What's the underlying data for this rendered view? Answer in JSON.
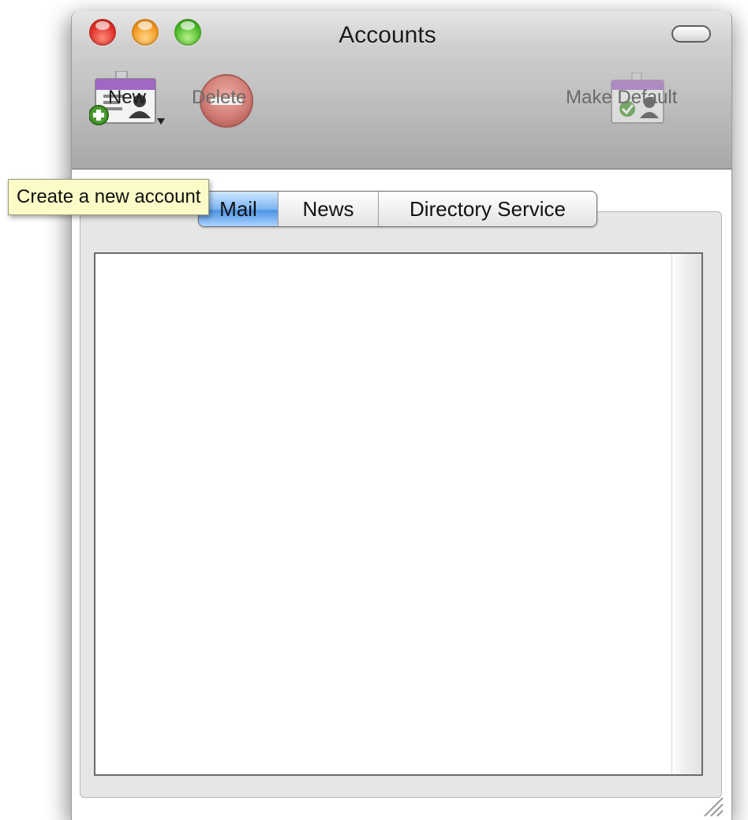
{
  "window": {
    "title": "Accounts"
  },
  "toolbar": {
    "new_label": "New",
    "delete_label": "Delete",
    "make_default_label": "Make Default"
  },
  "tooltip": {
    "text": "Create a new account"
  },
  "tabs": [
    {
      "label": "Mail",
      "selected": true
    },
    {
      "label": "News",
      "selected": false
    },
    {
      "label": "Directory Service",
      "selected": false
    }
  ],
  "account_list": {
    "items": []
  },
  "colors": {
    "tooltip_bg": "#fcfbc8",
    "selected_tab": "#4f94e6",
    "titlebar": "#bdbdbd"
  }
}
